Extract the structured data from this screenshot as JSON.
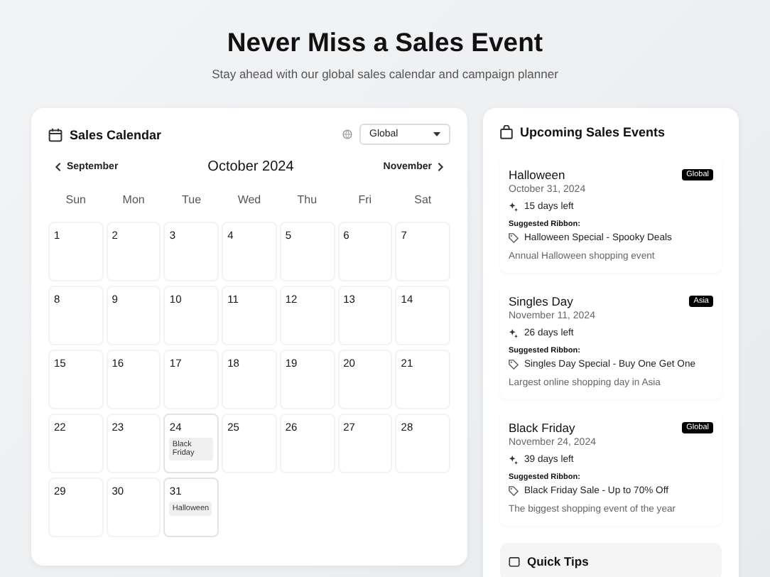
{
  "header": {
    "title": "Never Miss a Sales Event",
    "subtitle": "Stay ahead with our global sales calendar and campaign planner"
  },
  "calendar": {
    "title": "Sales Calendar",
    "region_select": {
      "value": "Global"
    },
    "prev": "September",
    "month": "October 2024",
    "next": "November",
    "weekdays": [
      "Sun",
      "Mon",
      "Tue",
      "Wed",
      "Thu",
      "Fri",
      "Sat"
    ],
    "days": [
      {
        "day": "1"
      },
      {
        "day": "2"
      },
      {
        "day": "3"
      },
      {
        "day": "4"
      },
      {
        "day": "5"
      },
      {
        "day": "6"
      },
      {
        "day": "7"
      },
      {
        "day": "8"
      },
      {
        "day": "9"
      },
      {
        "day": "10"
      },
      {
        "day": "11"
      },
      {
        "day": "12"
      },
      {
        "day": "13"
      },
      {
        "day": "14"
      },
      {
        "day": "15"
      },
      {
        "day": "16"
      },
      {
        "day": "17"
      },
      {
        "day": "18"
      },
      {
        "day": "19"
      },
      {
        "day": "20"
      },
      {
        "day": "21"
      },
      {
        "day": "22"
      },
      {
        "day": "23"
      },
      {
        "day": "24",
        "events": [
          "Black Friday"
        ]
      },
      {
        "day": "25"
      },
      {
        "day": "26"
      },
      {
        "day": "27"
      },
      {
        "day": "28"
      },
      {
        "day": "29"
      },
      {
        "day": "30"
      },
      {
        "day": "31",
        "events": [
          "Halloween"
        ]
      }
    ]
  },
  "upcoming": {
    "title": "Upcoming Sales Events",
    "events": [
      {
        "name": "Halloween",
        "badge": "Global",
        "date": "October 31, 2024",
        "countdown": "15 days left",
        "ribbon_label": "Suggested Ribbon:",
        "ribbon": "Halloween Special - Spooky Deals",
        "description": "Annual Halloween shopping event"
      },
      {
        "name": "Singles Day",
        "badge": "Asia",
        "date": "November 11, 2024",
        "countdown": "26 days left",
        "ribbon_label": "Suggested Ribbon:",
        "ribbon": "Singles Day Special - Buy One Get One",
        "description": "Largest online shopping day in Asia"
      },
      {
        "name": "Black Friday",
        "badge": "Global",
        "date": "November 24, 2024",
        "countdown": "39 days left",
        "ribbon_label": "Suggested Ribbon:",
        "ribbon": "Black Friday Sale - Up to 70% Off",
        "description": "The biggest shopping event of the year"
      }
    ],
    "tips_title": "Quick Tips"
  }
}
